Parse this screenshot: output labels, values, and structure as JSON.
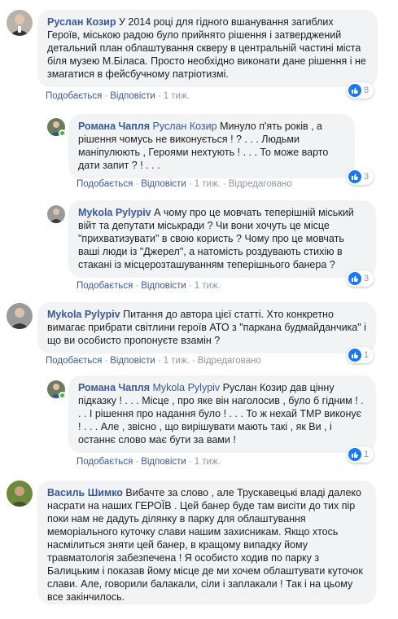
{
  "comments": [
    {
      "author": "Руслан Козир",
      "mention": "",
      "text": "У 2014 році для гідного вшанування загиблих Героїв, міською радою було прийнято рішення і затверджений детальний план облаштування скверу в центральній частині міста біля музею М.Біласа. Просто необхідно виконати дане рішення і не змагатися в фейсбучному патріотизмі.",
      "like": "Подобається",
      "reply": "Відповісти",
      "time": "1 тиж.",
      "edited": "",
      "reactions": "8"
    },
    {
      "author": "Романа Чапля",
      "mention": "Руслан Козир",
      "text": "Минуло п'ять років , а рішення чомусь не виконується ! ? . . . Людьми маніпулюють , Героями нехтують ! . . . То може варто дати запит ? ! . . .",
      "like": "Подобається",
      "reply": "Відповісти",
      "time": "1 тиж.",
      "edited": "Відредаговано",
      "reactions": "3"
    },
    {
      "author": "Mykola Pylypiv",
      "mention": "",
      "text": "А чому про це мовчать теперішній міський війт та депутати міськради ? Чи вони хочуть це місце \"прихватизувати\" в свою користь ? Чому про це мовчать ваші люди із \"Джерел\", а натомість роздувають стихію в стакані із місцерозташуванням теперішнього банера ?",
      "like": "Подобається",
      "reply": "Відповісти",
      "time": "1 тиж.",
      "edited": "",
      "reactions": "3"
    },
    {
      "author": "Mykola Pylypiv",
      "mention": "",
      "text": "Питання до автора цієї статті. Хто конкретно вимагає прибрати світлини героїв АТО з \"паркана будмайданчика\" і що ви особисто пропонуєте взамін ?",
      "like": "Подобається",
      "reply": "Відповісти",
      "time": "1 тиж.",
      "edited": "Відредаговано",
      "reactions": "1"
    },
    {
      "author": "Романа Чапля",
      "mention": "Mykola Pylypiv",
      "text": "Руслан Козир дав цінну підказку ! . . . Місце , про яке він наголосив , було б гідним ! . . . І рішення про надання було ! . . . То ж нехай ТМР виконує ! . . . Але , звісно , що вирішувати мають такі , як Ви , і останнє слово має бути за вами !",
      "like": "Подобається",
      "reply": "Відповісти",
      "time": "1 тиж.",
      "edited": "",
      "reactions": "1"
    },
    {
      "author": "Василь Шимко",
      "mention": "",
      "text": "Вибачте за слово , але Трускавецькі владі далеко насрати на наших ГЕРОЇВ . Цей банер буде там висіти до тих пір поки нам не дадуть ділянку в парку для облаштування меморіального куточку слави нашим захисникам. Якщо хтось насмілиться зняти цей банер, в кращому випадку йому травматологія забезпечена ! Я особисто ходив по парку з Балицьким і показав йому місце де ми хочем облаштувати куточок слави. Але, говорили балакали, сіли і заплакали ! Так і на цьому все закінчилось.",
      "like": "",
      "reply": "",
      "time": "",
      "edited": "",
      "reactions": ""
    }
  ],
  "separator": "·",
  "icons": {
    "reaction": "like-thumb-icon",
    "avatar": "avatar-photo",
    "status": "online-dot"
  },
  "colors": {
    "link": "#385898",
    "bubble": "#f2f3f5",
    "like": "#1877f2",
    "meta": "#90949c"
  }
}
